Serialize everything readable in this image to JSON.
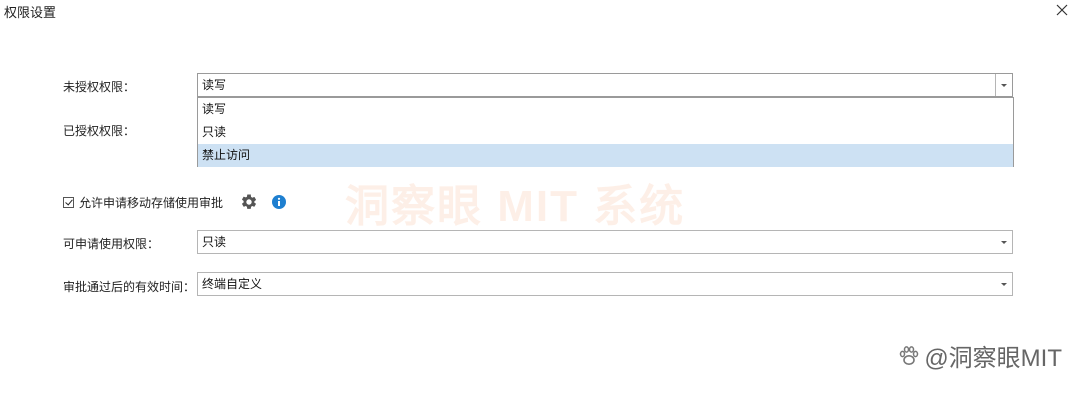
{
  "window": {
    "title": "权限设置"
  },
  "form": {
    "unauthorized": {
      "label": "未授权权限：",
      "value": "读写"
    },
    "authorized": {
      "label": "已授权权限："
    },
    "dropdown": {
      "options": [
        "读写",
        "只读",
        "禁止访问"
      ],
      "highlighted": "禁止访问"
    },
    "allow_removable": {
      "label": "允许申请移动存储使用审批",
      "checked": true
    },
    "applicable": {
      "label": "可申请使用权限：",
      "value": "只读"
    },
    "validity": {
      "label": "审批通过后的有效时间：",
      "value": "终端自定义"
    }
  },
  "watermark": {
    "center": "洞察眼 MIT 系统",
    "corner": "@洞察眼MIT"
  },
  "colors": {
    "highlight": "#cde1f3",
    "info_blue": "#1e7fd0",
    "border": "#b5b5b5"
  },
  "icons": {
    "close": "close-icon",
    "gear": "gear-icon",
    "info": "info-icon",
    "dropdown": "chevron-down-icon"
  }
}
